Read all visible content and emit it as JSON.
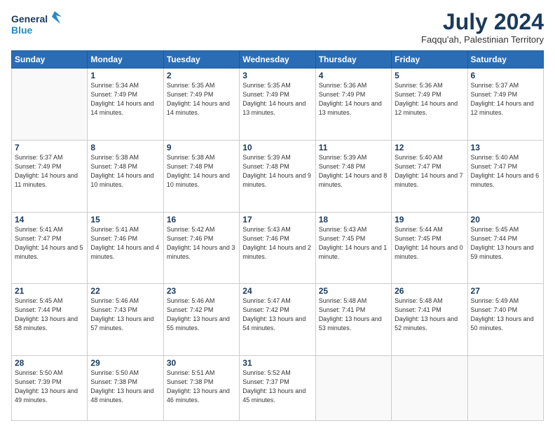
{
  "header": {
    "logo_line1": "General",
    "logo_line2": "Blue",
    "title": "July 2024",
    "subtitle": "Faqqu'ah, Palestinian Territory"
  },
  "weekdays": [
    "Sunday",
    "Monday",
    "Tuesday",
    "Wednesday",
    "Thursday",
    "Friday",
    "Saturday"
  ],
  "weeks": [
    [
      {
        "day": "",
        "info": ""
      },
      {
        "day": "1",
        "info": "Sunrise: 5:34 AM\nSunset: 7:49 PM\nDaylight: 14 hours\nand 14 minutes."
      },
      {
        "day": "2",
        "info": "Sunrise: 5:35 AM\nSunset: 7:49 PM\nDaylight: 14 hours\nand 14 minutes."
      },
      {
        "day": "3",
        "info": "Sunrise: 5:35 AM\nSunset: 7:49 PM\nDaylight: 14 hours\nand 13 minutes."
      },
      {
        "day": "4",
        "info": "Sunrise: 5:36 AM\nSunset: 7:49 PM\nDaylight: 14 hours\nand 13 minutes."
      },
      {
        "day": "5",
        "info": "Sunrise: 5:36 AM\nSunset: 7:49 PM\nDaylight: 14 hours\nand 12 minutes."
      },
      {
        "day": "6",
        "info": "Sunrise: 5:37 AM\nSunset: 7:49 PM\nDaylight: 14 hours\nand 12 minutes."
      }
    ],
    [
      {
        "day": "7",
        "info": "Sunrise: 5:37 AM\nSunset: 7:49 PM\nDaylight: 14 hours\nand 11 minutes."
      },
      {
        "day": "8",
        "info": "Sunrise: 5:38 AM\nSunset: 7:48 PM\nDaylight: 14 hours\nand 10 minutes."
      },
      {
        "day": "9",
        "info": "Sunrise: 5:38 AM\nSunset: 7:48 PM\nDaylight: 14 hours\nand 10 minutes."
      },
      {
        "day": "10",
        "info": "Sunrise: 5:39 AM\nSunset: 7:48 PM\nDaylight: 14 hours\nand 9 minutes."
      },
      {
        "day": "11",
        "info": "Sunrise: 5:39 AM\nSunset: 7:48 PM\nDaylight: 14 hours\nand 8 minutes."
      },
      {
        "day": "12",
        "info": "Sunrise: 5:40 AM\nSunset: 7:47 PM\nDaylight: 14 hours\nand 7 minutes."
      },
      {
        "day": "13",
        "info": "Sunrise: 5:40 AM\nSunset: 7:47 PM\nDaylight: 14 hours\nand 6 minutes."
      }
    ],
    [
      {
        "day": "14",
        "info": "Sunrise: 5:41 AM\nSunset: 7:47 PM\nDaylight: 14 hours\nand 5 minutes."
      },
      {
        "day": "15",
        "info": "Sunrise: 5:41 AM\nSunset: 7:46 PM\nDaylight: 14 hours\nand 4 minutes."
      },
      {
        "day": "16",
        "info": "Sunrise: 5:42 AM\nSunset: 7:46 PM\nDaylight: 14 hours\nand 3 minutes."
      },
      {
        "day": "17",
        "info": "Sunrise: 5:43 AM\nSunset: 7:46 PM\nDaylight: 14 hours\nand 2 minutes."
      },
      {
        "day": "18",
        "info": "Sunrise: 5:43 AM\nSunset: 7:45 PM\nDaylight: 14 hours\nand 1 minute."
      },
      {
        "day": "19",
        "info": "Sunrise: 5:44 AM\nSunset: 7:45 PM\nDaylight: 14 hours\nand 0 minutes."
      },
      {
        "day": "20",
        "info": "Sunrise: 5:45 AM\nSunset: 7:44 PM\nDaylight: 13 hours\nand 59 minutes."
      }
    ],
    [
      {
        "day": "21",
        "info": "Sunrise: 5:45 AM\nSunset: 7:44 PM\nDaylight: 13 hours\nand 58 minutes."
      },
      {
        "day": "22",
        "info": "Sunrise: 5:46 AM\nSunset: 7:43 PM\nDaylight: 13 hours\nand 57 minutes."
      },
      {
        "day": "23",
        "info": "Sunrise: 5:46 AM\nSunset: 7:42 PM\nDaylight: 13 hours\nand 55 minutes."
      },
      {
        "day": "24",
        "info": "Sunrise: 5:47 AM\nSunset: 7:42 PM\nDaylight: 13 hours\nand 54 minutes."
      },
      {
        "day": "25",
        "info": "Sunrise: 5:48 AM\nSunset: 7:41 PM\nDaylight: 13 hours\nand 53 minutes."
      },
      {
        "day": "26",
        "info": "Sunrise: 5:48 AM\nSunset: 7:41 PM\nDaylight: 13 hours\nand 52 minutes."
      },
      {
        "day": "27",
        "info": "Sunrise: 5:49 AM\nSunset: 7:40 PM\nDaylight: 13 hours\nand 50 minutes."
      }
    ],
    [
      {
        "day": "28",
        "info": "Sunrise: 5:50 AM\nSunset: 7:39 PM\nDaylight: 13 hours\nand 49 minutes."
      },
      {
        "day": "29",
        "info": "Sunrise: 5:50 AM\nSunset: 7:38 PM\nDaylight: 13 hours\nand 48 minutes."
      },
      {
        "day": "30",
        "info": "Sunrise: 5:51 AM\nSunset: 7:38 PM\nDaylight: 13 hours\nand 46 minutes."
      },
      {
        "day": "31",
        "info": "Sunrise: 5:52 AM\nSunset: 7:37 PM\nDaylight: 13 hours\nand 45 minutes."
      },
      {
        "day": "",
        "info": ""
      },
      {
        "day": "",
        "info": ""
      },
      {
        "day": "",
        "info": ""
      }
    ]
  ]
}
